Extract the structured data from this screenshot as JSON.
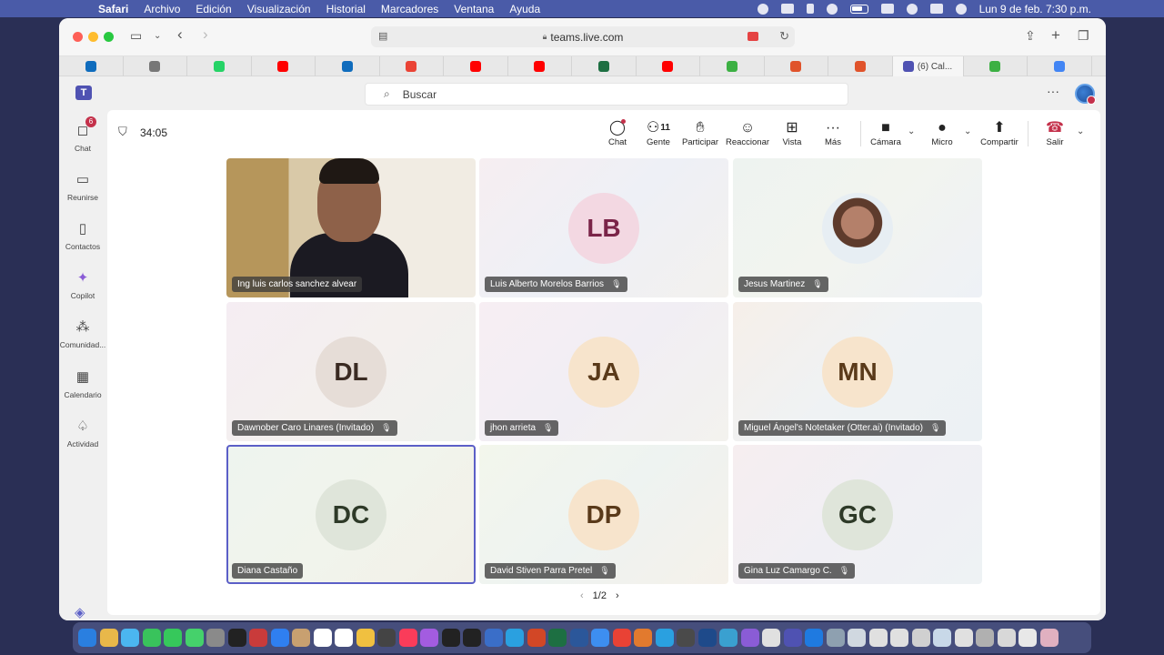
{
  "menubar": {
    "items": [
      "Safari",
      "Archivo",
      "Edición",
      "Visualización",
      "Historial",
      "Marcadores",
      "Ventana",
      "Ayuda"
    ],
    "datetime": "Lun 9 de feb.  7:30 p.m."
  },
  "browser": {
    "url": "teams.live.com",
    "active_tab_title": "(6) Cal..."
  },
  "tabs": [
    {
      "favicon": "outlook-icon",
      "color": "#0f6cbd"
    },
    {
      "favicon": "m-icon",
      "color": "#777777"
    },
    {
      "favicon": "whatsapp-icon",
      "color": "#25d366"
    },
    {
      "favicon": "youtube-icon",
      "color": "#ff0000"
    },
    {
      "favicon": "outlook-icon",
      "color": "#0f6cbd"
    },
    {
      "favicon": "gmail-icon",
      "color": "#ea4335"
    },
    {
      "favicon": "youtube-icon",
      "color": "#ff0000"
    },
    {
      "favicon": "youtube-icon",
      "color": "#ff0000"
    },
    {
      "favicon": "excel-icon",
      "color": "#1d6f42"
    },
    {
      "favicon": "youtube-icon",
      "color": "#ff0000"
    },
    {
      "favicon": "green-icon",
      "color": "#3cb043"
    },
    {
      "favicon": "star-icon",
      "color": "#e0532b"
    },
    {
      "favicon": "star-icon",
      "color": "#e0532b"
    },
    {
      "favicon": "teams-icon",
      "color": "#4f52b2",
      "active": true
    },
    {
      "favicon": "green-icon",
      "color": "#3cb043"
    },
    {
      "favicon": "google-icon",
      "color": "#4285f4"
    }
  ],
  "rail": {
    "chat": "Chat",
    "chat_badge": "6",
    "meet": "Reunirse",
    "contacts": "Contactos",
    "copilot": "Copilot",
    "community": "Comunidad...",
    "calendar": "Calendario",
    "activity": "Actividad"
  },
  "search": {
    "placeholder": "Buscar"
  },
  "meeting": {
    "timer": "34:05",
    "controls": {
      "chat": "Chat",
      "people": "Gente",
      "people_count": "11",
      "raise": "Participar",
      "react": "Reaccionar",
      "view": "Vista",
      "more": "Más",
      "camera": "Cámara",
      "mic": "Micro",
      "share": "Compartir",
      "leave": "Salir"
    },
    "participants": [
      {
        "name": "Ing luis carlos sanchez alvear",
        "initials": "",
        "video": true,
        "muted": false
      },
      {
        "name": "Luis Alberto Morelos Barrios",
        "initials": "LB",
        "muted": true
      },
      {
        "name": "Jesus Martinez",
        "initials": "",
        "photo": true,
        "muted": true
      },
      {
        "name": "Dawnober Caro Linares (Invitado)",
        "initials": "DL",
        "muted": true
      },
      {
        "name": "jhon arrieta",
        "initials": "JA",
        "muted": true
      },
      {
        "name": "Miguel Ángel's Notetaker (Otter.ai) (Invitado)",
        "initials": "MN",
        "muted": true
      },
      {
        "name": "Diana Castaño",
        "initials": "DC",
        "muted": false,
        "selected": true
      },
      {
        "name": "David Stiven Parra Pretel",
        "initials": "DP",
        "muted": true
      },
      {
        "name": "Gina Luz Camargo C.",
        "initials": "GC",
        "muted": true
      }
    ],
    "pager": "1/2"
  },
  "colors": {
    "accent": "#5b5fc7",
    "leave": "#c4314b"
  }
}
